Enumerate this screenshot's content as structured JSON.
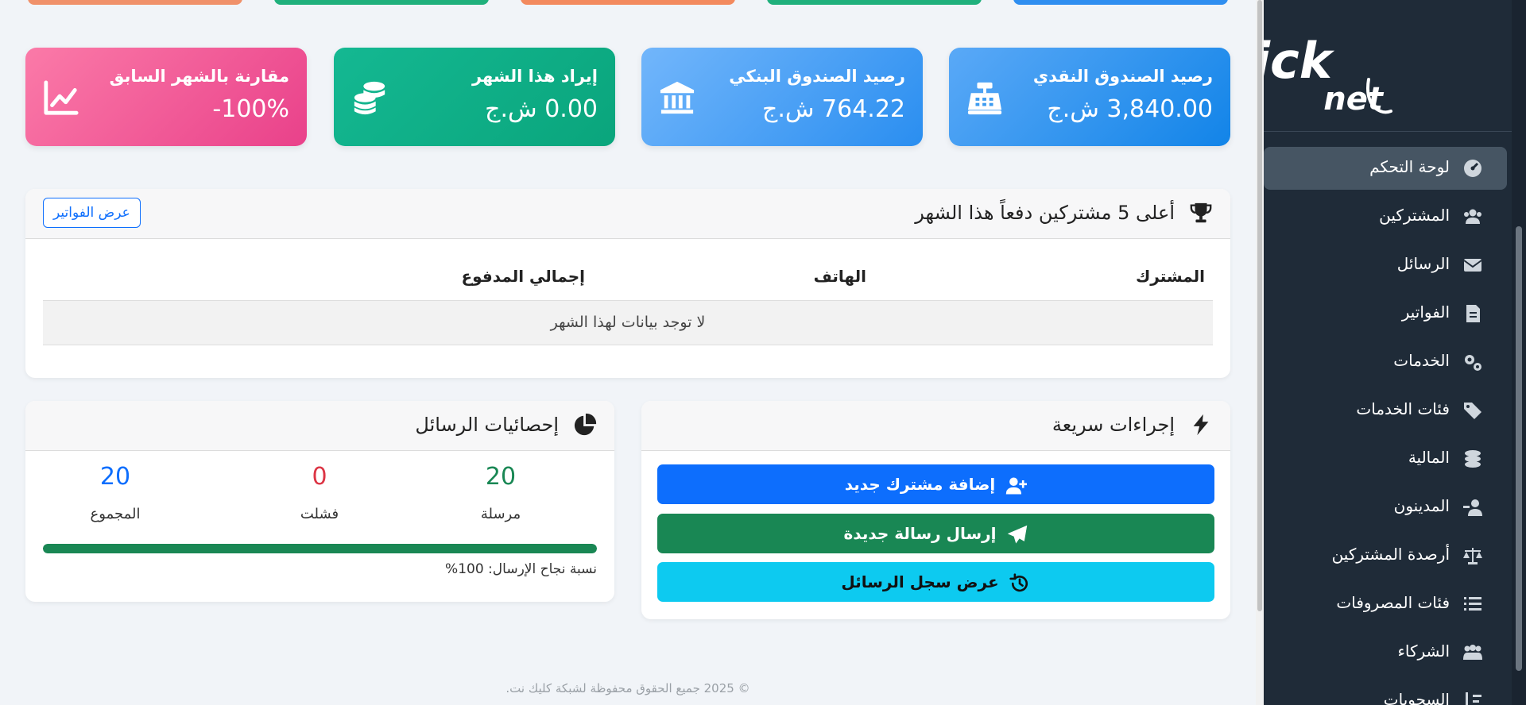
{
  "colors": {
    "sidebar_bg": "#1f2b38",
    "card_cash": "#1f8ef1",
    "card_bank": "#3d9bf0",
    "card_income": "#10ac84",
    "card_compare": "#ee4e8f",
    "primary": "#0d6efd",
    "success": "#198754",
    "info": "#0dcaf0"
  },
  "logo": {
    "word1": "click",
    "word2": "net"
  },
  "sidebar": {
    "items": [
      {
        "label": "لوحة التحكم",
        "icon": "dashboard-icon",
        "active": true
      },
      {
        "label": "المشتركين",
        "icon": "users-icon"
      },
      {
        "label": "الرسائل",
        "icon": "envelope-icon"
      },
      {
        "label": "الفواتير",
        "icon": "invoice-icon"
      },
      {
        "label": "الخدمات",
        "icon": "cogs-icon"
      },
      {
        "label": "فئات الخدمات",
        "icon": "tags-icon"
      },
      {
        "label": "المالية",
        "icon": "coins-icon"
      },
      {
        "label": "المدينون",
        "icon": "user-minus-icon"
      },
      {
        "label": "أرصدة المشتركين",
        "icon": "balance-scale-icon"
      },
      {
        "label": "فئات المصروفات",
        "icon": "list-icon"
      },
      {
        "label": "الشركاء",
        "icon": "partners-icon"
      },
      {
        "label": "السحوبات",
        "icon": "sort-down-icon"
      }
    ]
  },
  "cards": {
    "cash": {
      "title": "رصيد الصندوق النقدي",
      "value": "3,840.00 ش.ج",
      "icon": "cash-register-icon"
    },
    "bank": {
      "title": "رصيد الصندوق البنكي",
      "value": "764.22 ش.ج",
      "icon": "bank-icon"
    },
    "income": {
      "title": "إيراد هذا الشهر",
      "value": "0.00 ش.ج",
      "icon": "coins-icon"
    },
    "compare": {
      "title": "مقارنة بالشهر السابق",
      "value": "-100%",
      "icon": "chart-line-icon"
    }
  },
  "top_payers": {
    "title": "أعلى 5 مشتركين دفعاً هذا الشهر",
    "view_invoices": "عرض الفواتير",
    "columns": [
      "المشترك",
      "الهاتف",
      "إجمالي المدفوع"
    ],
    "empty_text": "لا توجد بيانات لهذا الشهر"
  },
  "quick_actions": {
    "title": "إجراءات سريعة",
    "add_subscriber": "إضافة مشترك جديد",
    "send_message": "إرسال رسالة جديدة",
    "view_log": "عرض سجل الرسائل"
  },
  "message_stats": {
    "title": "إحصائيات الرسائل",
    "sent_value": "20",
    "sent_label": "مرسلة",
    "failed_value": "0",
    "failed_label": "فشلت",
    "total_value": "20",
    "total_label": "المجموع",
    "success_rate": 1.0,
    "rate_text": "نسبة نجاح الإرسال: 100%"
  },
  "footer": "© 2025 جميع الحقوق محفوظة لشبكة كليك نت."
}
